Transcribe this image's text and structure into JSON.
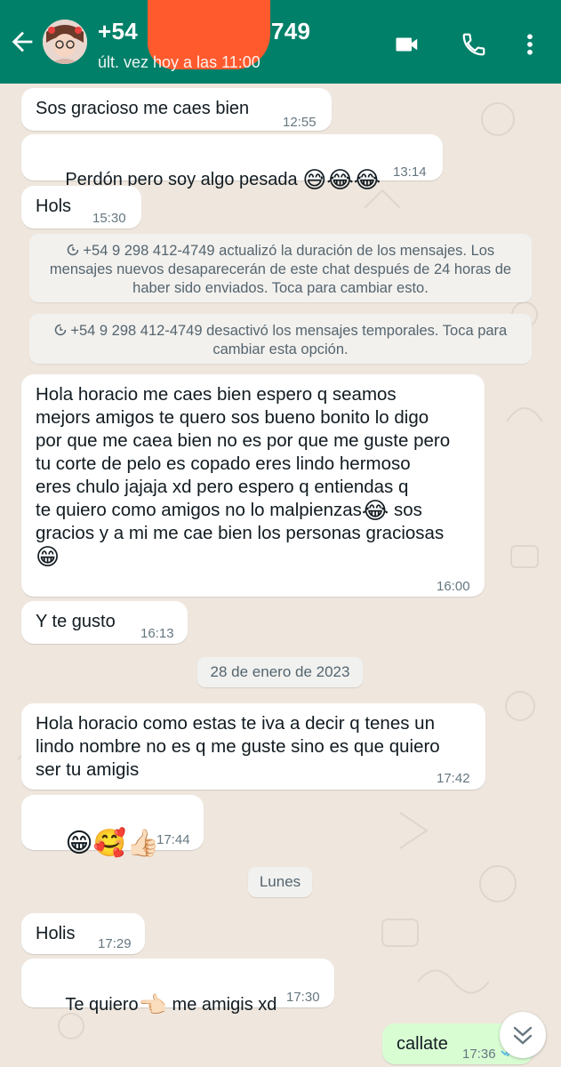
{
  "header": {
    "contact_name": "+54 9 298 412-4749",
    "contact_name_visible": "+54",
    "contact_name_tail": "749",
    "last_seen": "últ. vez hoy a las 11:00",
    "colors": {
      "bar": "#008069",
      "redaction": "#ff5a2d"
    },
    "icons": [
      "back-arrow-icon",
      "video-call-icon",
      "phone-call-icon",
      "more-options-icon"
    ]
  },
  "messages": [
    {
      "type": "in",
      "text": "Sos gracioso me caes bien",
      "time": "12:55"
    },
    {
      "type": "in",
      "text": "Perdón pero soy algo pesada",
      "emoji": "😅😂😂",
      "time": "13:14"
    },
    {
      "type": "in",
      "text": "Hols",
      "time": "15:30"
    },
    {
      "type": "system",
      "text": "+54 9 298 412-4749 actualizó la duración de los mensajes. Los mensajes nuevos desaparecerán de este chat después de 24 horas de haber sido enviados. Toca para cambiar esto."
    },
    {
      "type": "system",
      "text": "+54 9 298 412-4749 desactivó los mensajes temporales. Toca para cambiar esta opción."
    },
    {
      "type": "in",
      "lines": [
        "Hola horacio me caes bien espero q seamos",
        "mejors amigos te quero sos bueno bonito lo digo",
        "por que me caea bien no es por que me guste pero",
        "tu corte de pelo es copado eres lindo hermoso",
        "eres chulo jajaja xd pero espero q entiendas q",
        "te quiero como amigos no lo malpienzas",
        "gracios y a mi me cae bien los personas graciosas"
      ],
      "inline_emoji": "😂",
      "after_emoji": " sos",
      "end_emoji": "😁",
      "time": "16:00"
    },
    {
      "type": "in",
      "text": "Y te gusto",
      "time": "16:13"
    },
    {
      "type": "date",
      "text": "28 de enero de 2023"
    },
    {
      "type": "in",
      "lines": [
        "Hola horacio como estas te iva a decir q tenes un",
        "lindo nombre no es q me guste sino es que quiero",
        "ser tu amigis"
      ],
      "time": "17:42"
    },
    {
      "type": "in",
      "emoji": "😁🥰👍🏻",
      "time": "17:44"
    },
    {
      "type": "date",
      "text": "Lunes"
    },
    {
      "type": "in",
      "text": "Holis",
      "time": "17:29"
    },
    {
      "type": "in",
      "text_a": "Te quiero",
      "emoji": "👈🏻",
      "text_b": " me amigis xd",
      "time": "17:30"
    },
    {
      "type": "out",
      "text": "callate",
      "time": "17:36"
    }
  ],
  "colors": {
    "chat_bg": "#efe7de",
    "incoming": "#ffffff",
    "outgoing": "#d9fdd3",
    "time": "#667781",
    "read_ticks": "#53bdeb"
  },
  "scroll_button": {
    "icon": "double-chevron-down-icon"
  }
}
